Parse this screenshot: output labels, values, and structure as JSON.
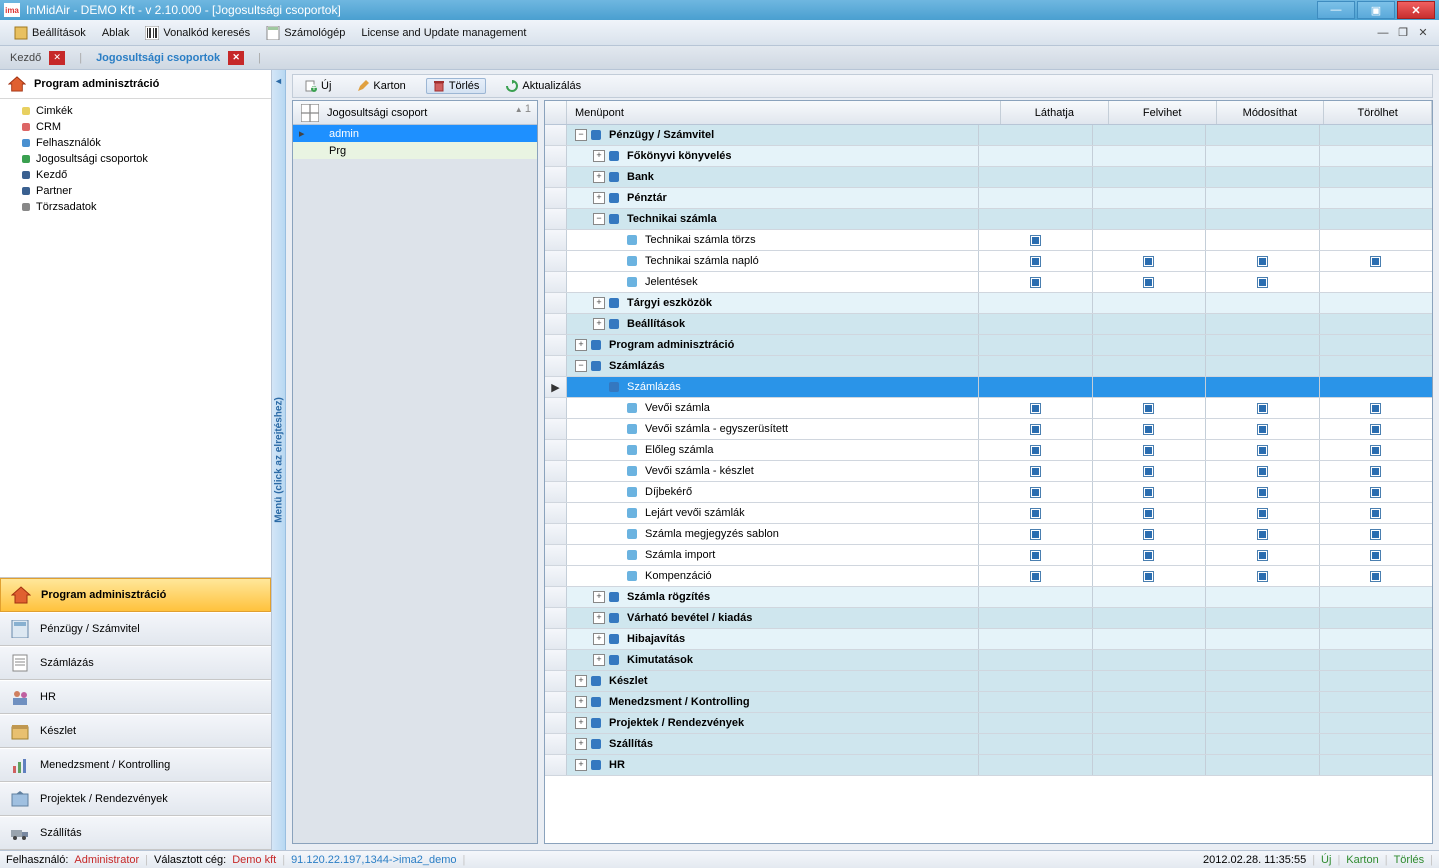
{
  "title": "InMidAir - DEMO Kft - v 2.10.000 - [Jogosultsági csoportok]",
  "menubar": {
    "settings": "Beállítások",
    "window": "Ablak",
    "barcode": "Vonalkód keresés",
    "calculator": "Számológép",
    "license": "License and Update management"
  },
  "tabs": {
    "kezdo": "Kezdő",
    "jogosult": "Jogosultsági csoportok"
  },
  "left": {
    "header": "Program adminisztráció",
    "tree": {
      "cimkek": "Cimkék",
      "crm": "CRM",
      "felhasznalok": "Felhasználók",
      "jogosult": "Jogosultsági csoportok",
      "kezdo": "Kezdő",
      "partner": "Partner",
      "torzs": "Törzsadatok"
    },
    "nav": {
      "admin": "Program adminisztráció",
      "penzugy": "Pénzügy / Számvitel",
      "szamlazas": "Számlázás",
      "hr": "HR",
      "keszlet": "Készlet",
      "menedzs": "Menedzsment / Kontrolling",
      "projektek": "Projektek / Rendezvények",
      "szallitas": "Szállítás"
    }
  },
  "collapser": "Menü (click az elrejtéshez)",
  "toolbar": {
    "uj": "Új",
    "karton": "Karton",
    "torles": "Törlés",
    "aktual": "Aktualizálás"
  },
  "groups": {
    "header": "Jogosultsági csoport",
    "sort": "1",
    "rows": {
      "admin": "admin",
      "prg": "Prg"
    }
  },
  "rights": {
    "headers": {
      "menu": "Menüpont",
      "see": "Láthatja",
      "add": "Felvihet",
      "mod": "Módosíthat",
      "del": "Törölhet"
    },
    "rows": [
      {
        "ind": 0,
        "exp": "−",
        "ico": "d",
        "txt": "Pénzügy / Számvitel",
        "cls": "",
        "p": [
          0,
          0,
          0,
          0
        ]
      },
      {
        "ind": 1,
        "exp": "+",
        "ico": "d",
        "txt": "Főkönyvi könyvelés",
        "cls": "light",
        "p": [
          0,
          0,
          0,
          0
        ]
      },
      {
        "ind": 1,
        "exp": "+",
        "ico": "d",
        "txt": "Bank",
        "cls": "",
        "p": [
          0,
          0,
          0,
          0
        ]
      },
      {
        "ind": 1,
        "exp": "+",
        "ico": "d",
        "txt": "Pénztár",
        "cls": "light",
        "p": [
          0,
          0,
          0,
          0
        ]
      },
      {
        "ind": 1,
        "exp": "−",
        "ico": "d",
        "txt": "Technikai számla",
        "cls": "",
        "p": [
          0,
          0,
          0,
          0
        ]
      },
      {
        "ind": 2,
        "exp": "",
        "ico": "l",
        "txt": "Technikai számla törzs",
        "cls": "white",
        "p": [
          1,
          0,
          0,
          0
        ]
      },
      {
        "ind": 2,
        "exp": "",
        "ico": "l",
        "txt": "Technikai számla napló",
        "cls": "white",
        "p": [
          1,
          1,
          1,
          1
        ]
      },
      {
        "ind": 2,
        "exp": "",
        "ico": "l",
        "txt": "Jelentések",
        "cls": "white",
        "p": [
          1,
          1,
          1,
          0
        ]
      },
      {
        "ind": 1,
        "exp": "+",
        "ico": "d",
        "txt": "Tárgyi eszközök",
        "cls": "light",
        "p": [
          0,
          0,
          0,
          0
        ]
      },
      {
        "ind": 1,
        "exp": "+",
        "ico": "d",
        "txt": "Beállítások",
        "cls": "",
        "p": [
          0,
          0,
          0,
          0
        ]
      },
      {
        "ind": 0,
        "exp": "+",
        "ico": "d",
        "txt": "Program adminisztráció",
        "cls": "",
        "gut": "",
        "p": [
          0,
          0,
          0,
          0
        ]
      },
      {
        "ind": 0,
        "exp": "−",
        "ico": "d",
        "txt": "Számlázás",
        "cls": "",
        "gut": "",
        "p": [
          0,
          0,
          0,
          0
        ]
      },
      {
        "ind": 1,
        "exp": "",
        "ico": "d",
        "txt": "Számlázás",
        "cls": "selblue",
        "gut": "▶",
        "p": [
          0,
          0,
          0,
          0
        ]
      },
      {
        "ind": 2,
        "exp": "",
        "ico": "l",
        "txt": "Vevői számla",
        "cls": "white",
        "p": [
          1,
          1,
          1,
          1
        ]
      },
      {
        "ind": 2,
        "exp": "",
        "ico": "l",
        "txt": "Vevői számla  - egyszerüsített",
        "cls": "white",
        "p": [
          1,
          1,
          1,
          1
        ]
      },
      {
        "ind": 2,
        "exp": "",
        "ico": "l",
        "txt": "Előleg számla",
        "cls": "white",
        "p": [
          1,
          1,
          1,
          1
        ]
      },
      {
        "ind": 2,
        "exp": "",
        "ico": "l",
        "txt": "Vevői számla - készlet",
        "cls": "white",
        "p": [
          1,
          1,
          1,
          1
        ]
      },
      {
        "ind": 2,
        "exp": "",
        "ico": "l",
        "txt": "Díjbekérő",
        "cls": "white",
        "p": [
          1,
          1,
          1,
          1
        ]
      },
      {
        "ind": 2,
        "exp": "",
        "ico": "l",
        "txt": "Lejárt vevői számlák",
        "cls": "white",
        "p": [
          1,
          1,
          1,
          1
        ]
      },
      {
        "ind": 2,
        "exp": "",
        "ico": "l",
        "txt": "Számla megjegyzés sablon",
        "cls": "white",
        "p": [
          1,
          1,
          1,
          1
        ]
      },
      {
        "ind": 2,
        "exp": "",
        "ico": "l",
        "txt": "Számla import",
        "cls": "white",
        "p": [
          1,
          1,
          1,
          1
        ]
      },
      {
        "ind": 2,
        "exp": "",
        "ico": "l",
        "txt": "Kompenzáció",
        "cls": "white",
        "p": [
          1,
          1,
          1,
          1
        ]
      },
      {
        "ind": 1,
        "exp": "+",
        "ico": "d",
        "txt": "Számla rögzítés",
        "cls": "light",
        "p": [
          0,
          0,
          0,
          0
        ]
      },
      {
        "ind": 1,
        "exp": "+",
        "ico": "d",
        "txt": "Várható bevétel / kiadás",
        "cls": "",
        "p": [
          0,
          0,
          0,
          0
        ]
      },
      {
        "ind": 1,
        "exp": "+",
        "ico": "d",
        "txt": "Hibajavítás",
        "cls": "light",
        "p": [
          0,
          0,
          0,
          0
        ]
      },
      {
        "ind": 1,
        "exp": "+",
        "ico": "d",
        "txt": "Kimutatások",
        "cls": "",
        "p": [
          0,
          0,
          0,
          0
        ]
      },
      {
        "ind": 0,
        "exp": "+",
        "ico": "d",
        "txt": "Készlet",
        "cls": "",
        "gut": "",
        "p": [
          0,
          0,
          0,
          0
        ]
      },
      {
        "ind": 0,
        "exp": "+",
        "ico": "d",
        "txt": "Menedzsment / Kontrolling",
        "cls": "",
        "gut": "",
        "p": [
          0,
          0,
          0,
          0
        ]
      },
      {
        "ind": 0,
        "exp": "+",
        "ico": "d",
        "txt": "Projektek / Rendezvények",
        "cls": "",
        "gut": "",
        "p": [
          0,
          0,
          0,
          0
        ]
      },
      {
        "ind": 0,
        "exp": "+",
        "ico": "d",
        "txt": "Szállítás",
        "cls": "",
        "gut": "",
        "p": [
          0,
          0,
          0,
          0
        ]
      },
      {
        "ind": 0,
        "exp": "+",
        "ico": "d",
        "txt": "HR",
        "cls": "",
        "gut": "",
        "p": [
          0,
          0,
          0,
          0
        ]
      }
    ]
  },
  "status": {
    "user_lbl": "Felhasználó:",
    "user": "Administrator",
    "firm_lbl": "Választott cég:",
    "firm": "Demo kft",
    "conn": "91.120.22.197,1344->ima2_demo",
    "time": "2012.02.28. 11:35:55",
    "uj": "Új",
    "karton": "Karton",
    "torles": "Törlés"
  }
}
